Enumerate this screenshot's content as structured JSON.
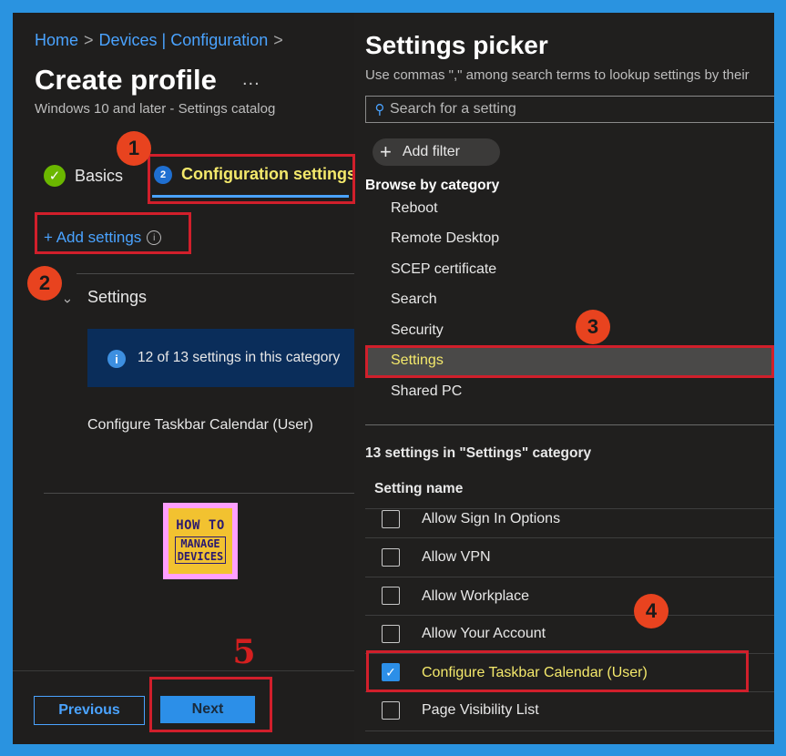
{
  "breadcrumb": {
    "home": "Home",
    "sep1": ">",
    "devices": "Devices | Configuration",
    "sep2": ">"
  },
  "page": {
    "title": "Create profile",
    "more": "...",
    "subtitle": "Windows 10 and later - Settings catalog"
  },
  "tabs": {
    "basics": "Basics",
    "config_step": "2",
    "config": "Configuration settings"
  },
  "add_settings": {
    "label": "+ Add settings",
    "info_icon": "i"
  },
  "settings_section": {
    "heading": "Settings",
    "info_text": "12 of 13 settings in this category",
    "configure_item": "Configure Taskbar Calendar (User)"
  },
  "logo": {
    "line1": "HOW TO",
    "line2": "MANAGE DEVICES"
  },
  "footer": {
    "previous": "Previous",
    "next": "Next"
  },
  "annotations": [
    "1",
    "2",
    "3",
    "4",
    "5"
  ],
  "picker": {
    "title": "Settings picker",
    "subtitle": "Use commas \",\" among search terms to lookup settings by their",
    "search_placeholder": "Search for a setting",
    "add_filter": "Add filter",
    "browse_heading": "Browse by category",
    "categories": [
      "Reboot",
      "Remote Desktop",
      "SCEP certificate",
      "Search",
      "Security",
      "Settings",
      "Shared PC"
    ],
    "selected_category": "Settings",
    "count_text": "13 settings in \"Settings\" category",
    "column_header": "Setting name",
    "rows": [
      {
        "label": "Allow Sign In Options",
        "checked": false
      },
      {
        "label": "Allow VPN",
        "checked": false
      },
      {
        "label": "Allow Workplace",
        "checked": false
      },
      {
        "label": "Allow Your Account",
        "checked": false
      },
      {
        "label": "Configure Taskbar Calendar (User)",
        "checked": true
      },
      {
        "label": "Page Visibility List",
        "checked": false
      }
    ]
  },
  "colors": {
    "accent": "#4aa3ff",
    "highlight_text": "#f4e96b",
    "annotation_red": "#d11f2b",
    "badge_orange": "#e8431f",
    "frame_blue": "#2a93e0"
  }
}
